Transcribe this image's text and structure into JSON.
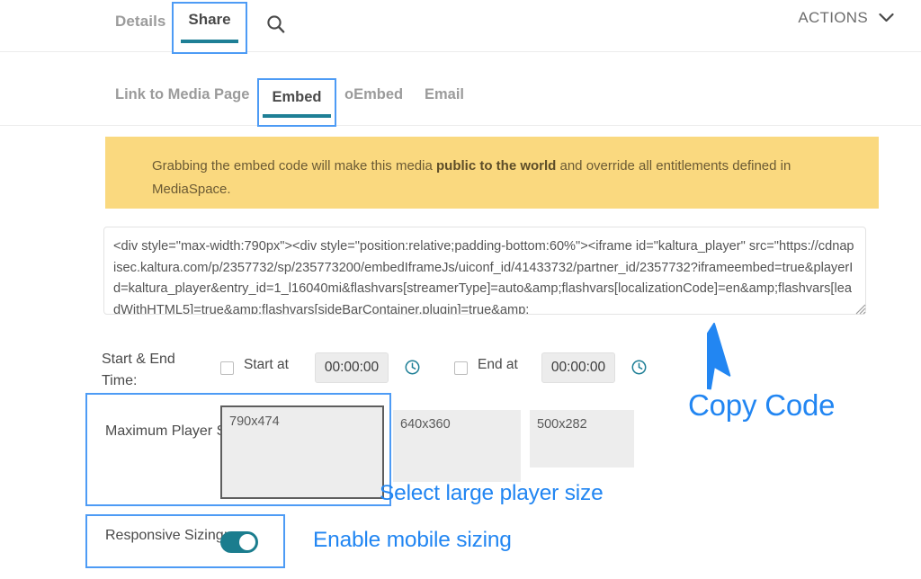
{
  "header": {
    "tabs": [
      {
        "label": "Details",
        "active": false
      },
      {
        "label": "Share",
        "active": true
      }
    ],
    "search_icon": "search-icon",
    "actions_label": "ACTIONS",
    "actions_chevron": "chevron-down-icon"
  },
  "subtabs": [
    {
      "label": "Link to Media Page",
      "active": false
    },
    {
      "label": "Embed",
      "active": true
    },
    {
      "label": "oEmbed",
      "active": false
    },
    {
      "label": "Email",
      "active": false
    }
  ],
  "banner": {
    "text_before": "Grabbing the embed code will make this media ",
    "text_bold": "public to the world",
    "text_after": " and override all entitlements defined in MediaSpace.",
    "background": "#fad97f"
  },
  "embed_code": {
    "value": "<div style=\"max-width:790px\"><div style=\"position:relative;padding-bottom:60%\"><iframe id=\"kaltura_player\" src=\"https://cdnapisec.kaltura.com/p/2357732/sp/235773200/embedIframeJs/uiconf_id/41433732/partner_id/2357732?iframeembed=true&playerId=kaltura_player&entry_id=1_l16040mi&flashvars[streamerType]=auto&amp;flashvars[localizationCode]=en&amp;flashvars[leadWithHTML5]=true&amp;flashvars[sideBarContainer.plugin]=true&amp;",
    "resize_grip": "resize-grip-icon"
  },
  "start_end_time": {
    "label": "Start & End Time:",
    "start_checkbox_label": "Start at",
    "start_checkbox_checked": false,
    "start_value": "00:00:00",
    "start_clock_icon": "clock-icon",
    "end_checkbox_label": "End at",
    "end_checkbox_checked": false,
    "end_value": "00:00:00",
    "end_clock_icon": "clock-icon"
  },
  "player_size": {
    "label": "Maximum Player Size",
    "options": [
      {
        "label": "790x474",
        "selected": true
      },
      {
        "label": "640x360",
        "selected": false
      },
      {
        "label": "500x282",
        "selected": false
      }
    ]
  },
  "responsive_sizing": {
    "label": "Responsive Sizing:",
    "toggle_on": true,
    "toggle_color": "#1b7d8e"
  },
  "annotations": {
    "color": "#2286f2",
    "highlight_color": "#4d9bf5",
    "copy_code": "Copy Code",
    "select_player_size": "Select large player size",
    "enable_mobile": "Enable mobile sizing",
    "arrow_icon": "cursor-arrow-icon"
  },
  "theme": {
    "accent_teal": "#1e7f96",
    "text_dark": "#4a4a4a",
    "text_muted": "#9b9b9b"
  }
}
